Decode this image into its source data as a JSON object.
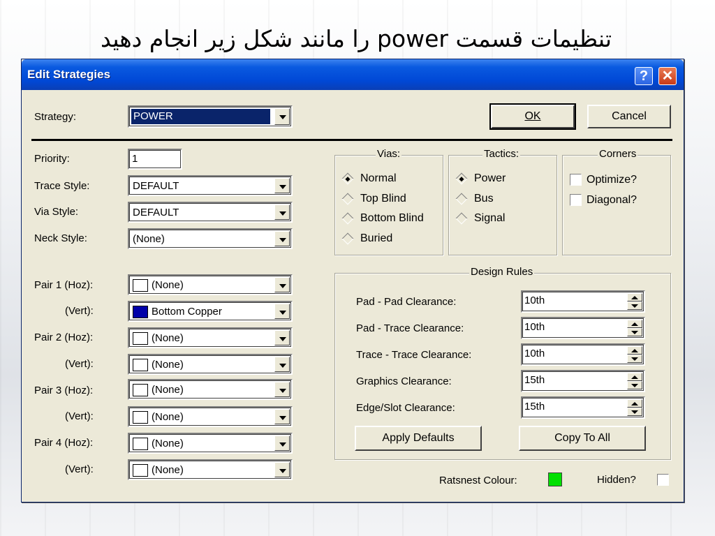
{
  "slide": {
    "title": "تنظیمات قسمت power را مانند شکل زیر انجام دهید"
  },
  "dialog": {
    "title": "Edit Strategies",
    "help_button": "?",
    "close_button": "✕",
    "strategy_label": "Strategy:",
    "strategy_value": "POWER",
    "ok_label": "OK",
    "cancel_label": "Cancel"
  },
  "left": {
    "priority_label": "Priority:",
    "priority_value": "1",
    "trace_style_label": "Trace Style:",
    "trace_style_value": "DEFAULT",
    "via_style_label": "Via Style:",
    "via_style_value": "DEFAULT",
    "neck_style_label": "Neck Style:",
    "neck_style_value": "(None)",
    "pairs": [
      {
        "label": "Pair 1 (Hoz):",
        "value": "(None)",
        "color": "#ffffff"
      },
      {
        "label": "(Vert):",
        "value": "Bottom Copper",
        "color": "#0000a8"
      },
      {
        "label": "Pair 2 (Hoz):",
        "value": "(None)",
        "color": "#ffffff"
      },
      {
        "label": "(Vert):",
        "value": "(None)",
        "color": "#ffffff"
      },
      {
        "label": "Pair 3 (Hoz):",
        "value": "(None)",
        "color": "#ffffff"
      },
      {
        "label": "(Vert):",
        "value": "(None)",
        "color": "#ffffff"
      },
      {
        "label": "Pair 4 (Hoz):",
        "value": "(None)",
        "color": "#ffffff"
      },
      {
        "label": "(Vert):",
        "value": "(None)",
        "color": "#ffffff"
      }
    ]
  },
  "vias": {
    "title": "Vias:",
    "options": [
      "Normal",
      "Top Blind",
      "Bottom Blind",
      "Buried"
    ],
    "selected": "Normal"
  },
  "tactics": {
    "title": "Tactics:",
    "options": [
      "Power",
      "Bus",
      "Signal"
    ],
    "selected": "Power"
  },
  "corners": {
    "title": "Corners",
    "options": [
      "Optimize?",
      "Diagonal?"
    ]
  },
  "design_rules": {
    "title": "Design Rules",
    "rows": [
      {
        "label": "Pad - Pad Clearance:",
        "value": "10th"
      },
      {
        "label": "Pad - Trace Clearance:",
        "value": "10th"
      },
      {
        "label": "Trace - Trace Clearance:",
        "value": "10th"
      },
      {
        "label": "Graphics Clearance:",
        "value": "15th"
      },
      {
        "label": "Edge/Slot Clearance:",
        "value": "15th"
      }
    ],
    "apply_defaults_label": "Apply Defaults",
    "copy_to_all_label": "Copy To All"
  },
  "footer": {
    "ratsnest_label": "Ratsnest Colour:",
    "ratsnest_color": "#00e000",
    "hidden_label": "Hidden?"
  }
}
